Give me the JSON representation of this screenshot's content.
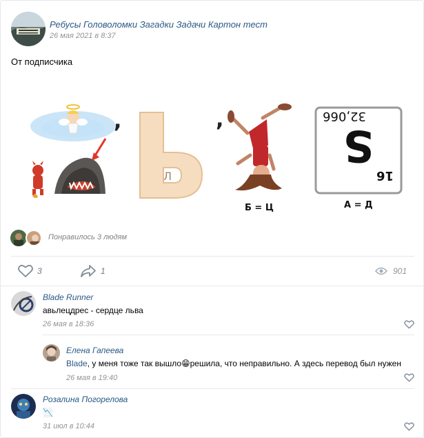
{
  "post": {
    "community_name": "Ребусы Головоломки Загадки Задачи Картон тест",
    "date": "26 мая 2021 в 8:37",
    "text": "От подписчика"
  },
  "puzzle": {
    "letter": "Ь",
    "inner_letter": "Л",
    "rule_b": "Б = Ц",
    "element_number": "16",
    "element_symbol": "S",
    "element_mass": "32,066",
    "rule_a": "А = Д"
  },
  "likes_bar": {
    "liked_text": "Понравилось 3 людям"
  },
  "actions": {
    "likes_count": "3",
    "shares_count": "1",
    "views_count": "901"
  },
  "comments": [
    {
      "author": "Blade Runner",
      "text": "авьлецдрес - сердце льва",
      "date": "26 мая в 18:36"
    },
    {
      "author": "Елена Гапеева",
      "mention": "Blade",
      "text_before_emoji": ", у меня тоже так вышло",
      "emoji": "😁",
      "text_after_emoji": "решила, что неправильно. А здесь перевод был нужен",
      "date": "26 мая в 19:40"
    },
    {
      "author": "Розалина Погорелова",
      "text": "📉",
      "date": "31 июл в 10:44"
    }
  ],
  "colors": {
    "link": "#2a5885",
    "muted": "#939393",
    "divider": "#e7e8ec",
    "icon": "#818c99"
  }
}
